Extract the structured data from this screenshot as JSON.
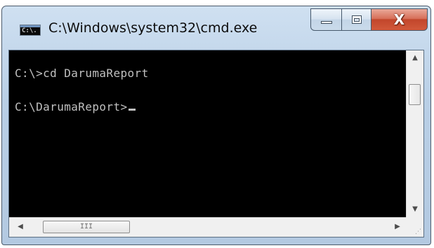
{
  "window": {
    "title": "C:\\Windows\\system32\\cmd.exe",
    "icon_label": "C:\\.",
    "icon": "console-app-icon",
    "buttons": {
      "minimize": "minimize-icon",
      "maximize": "maximize-icon",
      "close_glyph": "X"
    }
  },
  "console": {
    "lines": [
      "C:\\>cd DarumaReport",
      "C:\\DarumaReport>"
    ],
    "text_color": "#c0c0c0",
    "background_color": "#000000"
  },
  "scrollbars": {
    "vertical": {
      "up_arrow": "▲",
      "down_arrow": "▼"
    },
    "horizontal": {
      "left_arrow": "◀",
      "right_arrow": "▶",
      "thumb_grip": "III"
    },
    "size_grip": "⋰"
  },
  "colors": {
    "title_bar": "#c5d8ec",
    "close_button": "#c94a30"
  }
}
